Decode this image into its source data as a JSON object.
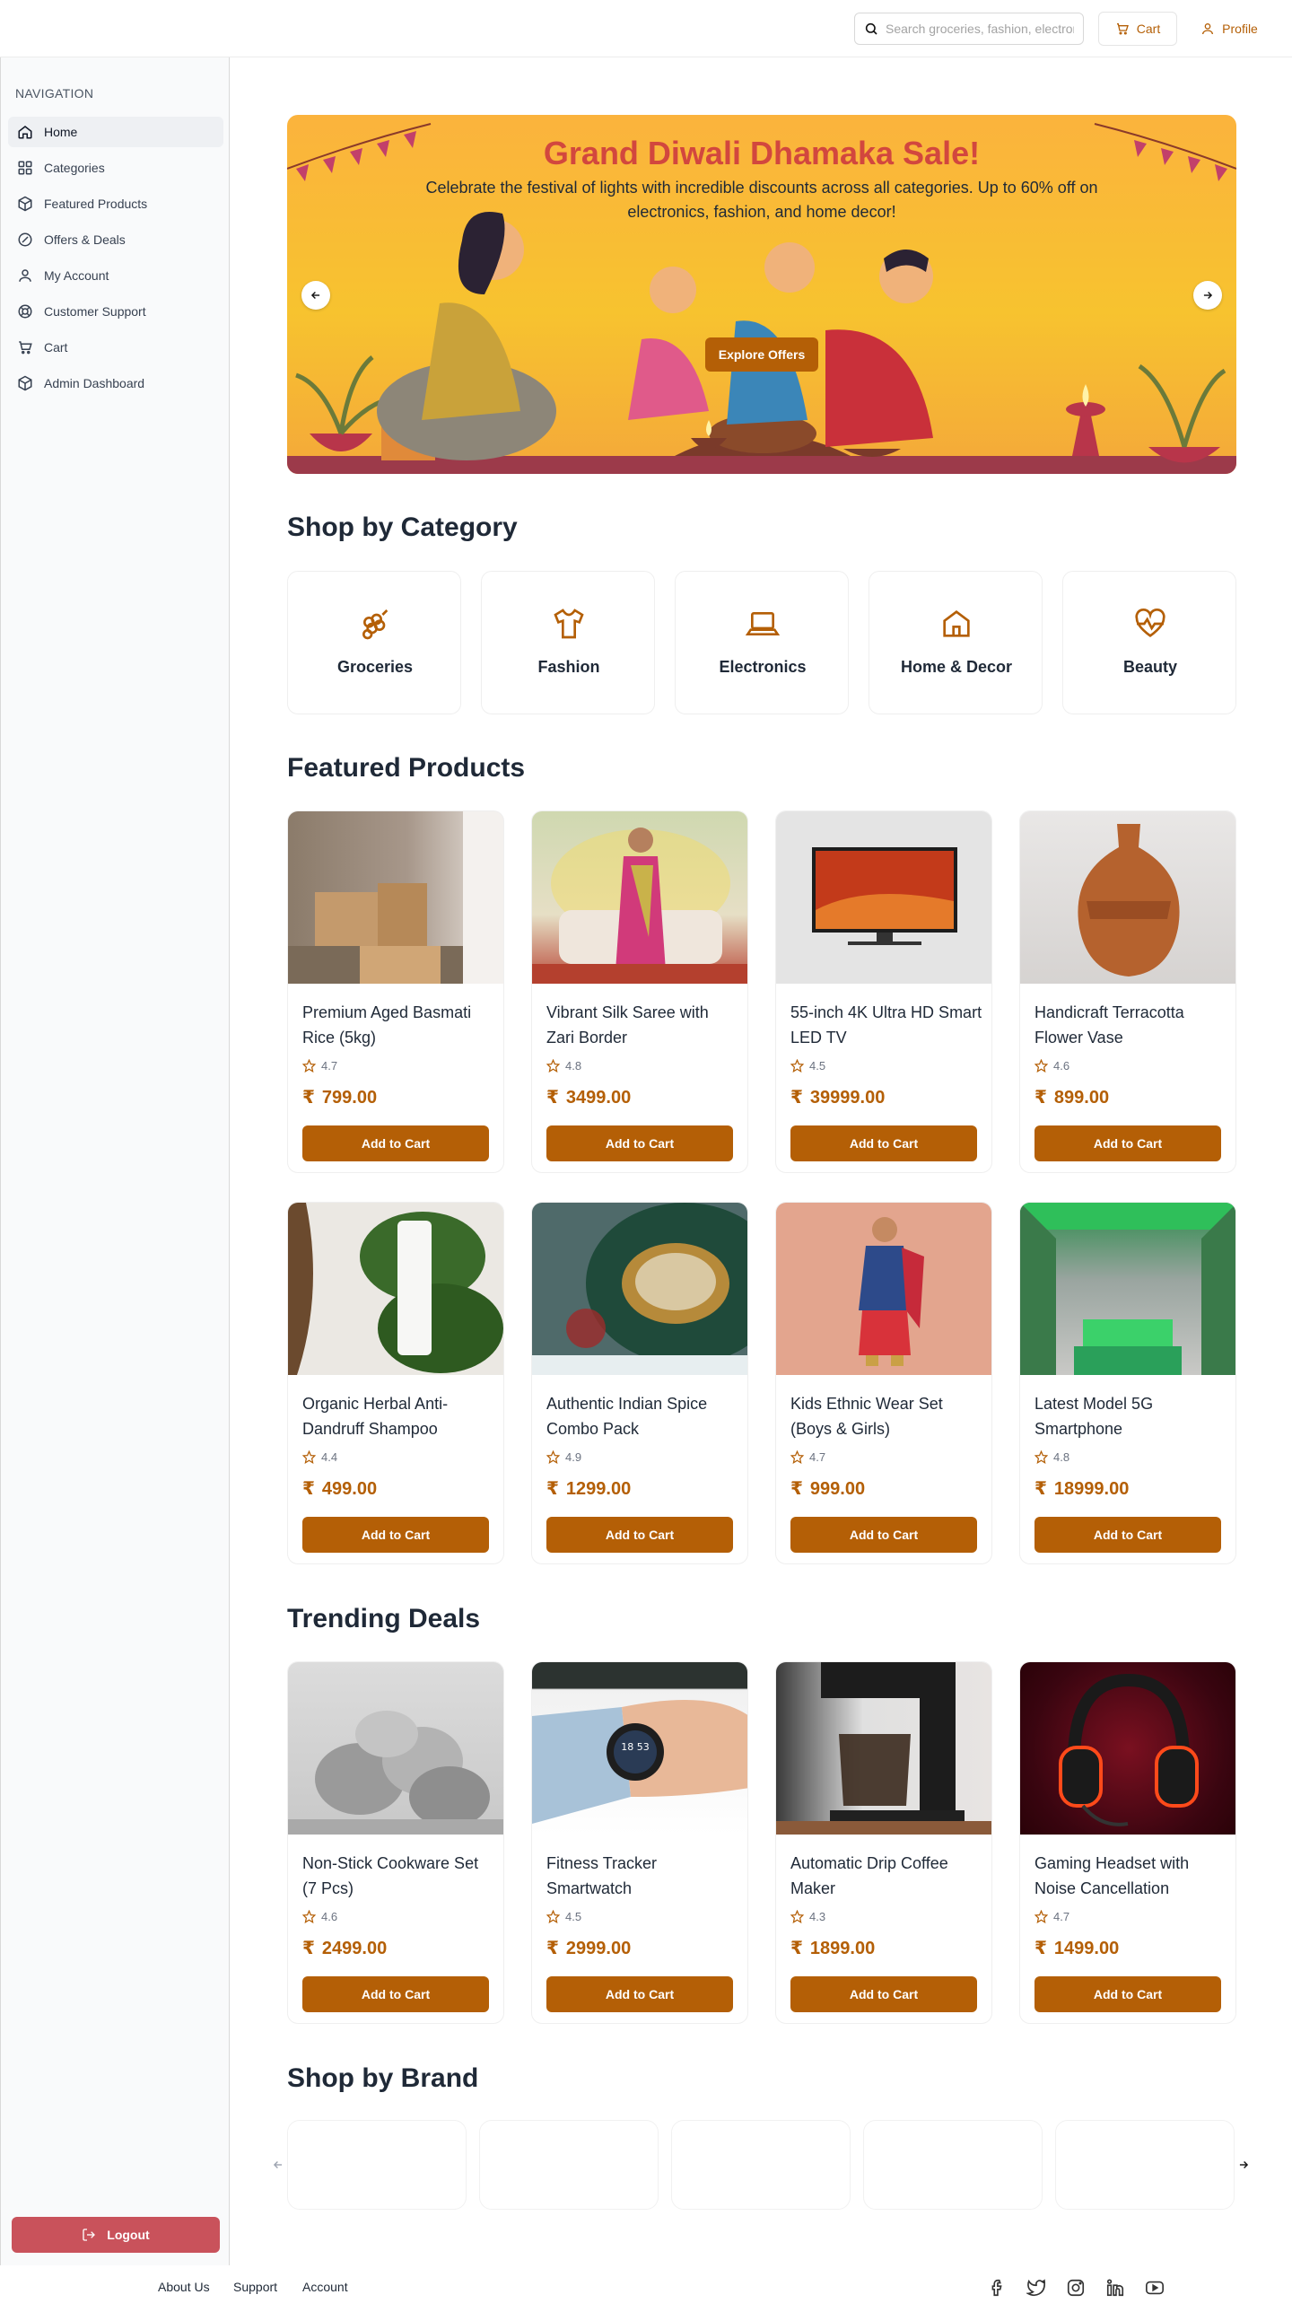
{
  "header": {
    "search_placeholder": "Search groceries, fashion, electronics...",
    "cart_label": "Cart",
    "profile_label": "Profile"
  },
  "sidebar": {
    "title": "NAVIGATION",
    "items": [
      {
        "label": "Home",
        "icon": "home-icon"
      },
      {
        "label": "Categories",
        "icon": "grid-icon"
      },
      {
        "label": "Featured Products",
        "icon": "box-icon"
      },
      {
        "label": "Offers & Deals",
        "icon": "percent-icon"
      },
      {
        "label": "My Account",
        "icon": "user-icon"
      },
      {
        "label": "Customer Support",
        "icon": "lifebuoy-icon"
      },
      {
        "label": "Cart",
        "icon": "cart-icon"
      },
      {
        "label": "Admin Dashboard",
        "icon": "box-icon"
      }
    ],
    "logout_label": "Logout"
  },
  "hero": {
    "title": "Grand Diwali Dhamaka Sale!",
    "subtitle": "Celebrate the festival of lights with incredible discounts across all categories. Up to 60% off on electronics, fashion, and home decor!",
    "cta": "Explore Offers"
  },
  "categories": {
    "title": "Shop by Category",
    "items": [
      {
        "label": "Groceries",
        "icon": "grapes-icon"
      },
      {
        "label": "Fashion",
        "icon": "shirt-icon"
      },
      {
        "label": "Electronics",
        "icon": "laptop-icon"
      },
      {
        "label": "Home & Decor",
        "icon": "house-icon"
      },
      {
        "label": "Beauty",
        "icon": "heart-pulse-icon"
      }
    ]
  },
  "featured": {
    "title": "Featured Products",
    "products": [
      {
        "name": "Premium Aged Basmati Rice (5kg)",
        "rating": "4.7",
        "price": "799.00"
      },
      {
        "name": "Vibrant Silk Saree with Zari Border",
        "rating": "4.8",
        "price": "3499.00"
      },
      {
        "name": "55-inch 4K Ultra HD Smart LED TV",
        "rating": "4.5",
        "price": "39999.00"
      },
      {
        "name": "Handicraft Terracotta Flower Vase",
        "rating": "4.6",
        "price": "899.00"
      },
      {
        "name": "Organic Herbal Anti-Dandruff Shampoo",
        "rating": "4.4",
        "price": "499.00"
      },
      {
        "name": "Authentic Indian Spice Combo Pack",
        "rating": "4.9",
        "price": "1299.00"
      },
      {
        "name": "Kids Ethnic Wear Set (Boys & Girls)",
        "rating": "4.7",
        "price": "999.00"
      },
      {
        "name": "Latest Model 5G Smartphone",
        "rating": "4.8",
        "price": "18999.00"
      }
    ]
  },
  "trending": {
    "title": "Trending Deals",
    "products": [
      {
        "name": "Non-Stick Cookware Set (7 Pcs)",
        "rating": "4.6",
        "price": "2499.00"
      },
      {
        "name": "Fitness Tracker Smartwatch",
        "rating": "4.5",
        "price": "2999.00"
      },
      {
        "name": "Automatic Drip Coffee Maker",
        "rating": "4.3",
        "price": "1899.00"
      },
      {
        "name": "Gaming Headset with Noise Cancellation",
        "rating": "4.7",
        "price": "1499.00"
      }
    ]
  },
  "brands": {
    "title": "Shop by Brand"
  },
  "common": {
    "add_to_cart": "Add to Cart",
    "currency": "₹",
    "watch_time": "18 53"
  },
  "footer": {
    "links": [
      "About Us",
      "Support",
      "Account"
    ]
  },
  "colors": {
    "accent": "#b45f06",
    "logout": "#c9525b",
    "hero_title": "#d2473e"
  }
}
